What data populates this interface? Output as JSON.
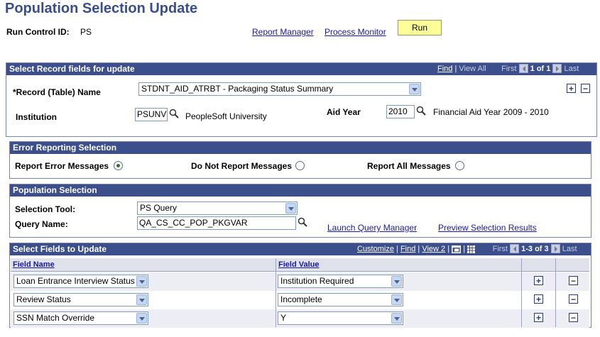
{
  "page_title": "Population Selection Update",
  "run_control": {
    "label": "Run Control ID:",
    "value": "PS"
  },
  "links": {
    "report_manager": "Report Manager",
    "process_monitor": "Process Monitor"
  },
  "run_button": "Run",
  "record_section": {
    "header": "Select Record fields for update",
    "nav": {
      "find": "Find",
      "sep": "|",
      "view_all": "View All",
      "first": "First",
      "count": "1 of 1",
      "last": "Last"
    },
    "record_name_label": "*Record (Table) Name",
    "record_name_value": "STDNT_AID_ATRBT - Packaging Status Summary",
    "institution_label": "Institution",
    "institution_value": "PSUNV",
    "institution_desc": "PeopleSoft University",
    "aid_year_label": "Aid Year",
    "aid_year_value": "2010",
    "aid_year_desc": "Financial Aid Year 2009 - 2010"
  },
  "error_section": {
    "header": "Error Reporting Selection",
    "options": [
      {
        "label": "Report Error Messages",
        "selected": true
      },
      {
        "label": "Do Not Report Messages",
        "selected": false
      },
      {
        "label": "Report All Messages",
        "selected": false
      }
    ]
  },
  "population_section": {
    "header": "Population Selection",
    "tool_label": "Selection Tool:",
    "tool_value": "PS Query",
    "query_label": "Query Name:",
    "query_value": "QA_CS_CC_POP_PKGVAR",
    "launch_link": "Launch Query Manager",
    "preview_link": "Preview Selection Results"
  },
  "fields_section": {
    "header": "Select Fields to Update",
    "nav": {
      "customize": "Customize",
      "find": "Find",
      "view": "View 2",
      "first": "First",
      "count": "1-3 of 3",
      "last": "Last"
    },
    "col_field_name": "Field Name",
    "col_field_value": "Field Value",
    "rows": [
      {
        "name": "Loan Entrance Interview Status",
        "value": "Institution Required"
      },
      {
        "name": "Review Status",
        "value": "Incomplete"
      },
      {
        "name": "SSN Match Override",
        "value": "Y"
      }
    ]
  },
  "colors": {
    "header_bg": "#3d4e8c",
    "title": "#3a4e8c",
    "run_button": "#ffff99",
    "link": "#1a1aa6"
  }
}
